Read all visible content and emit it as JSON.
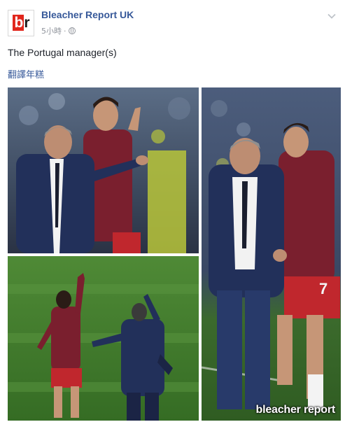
{
  "post": {
    "page_name": "Bleacher Report UK",
    "timestamp": "5小時",
    "separator": "·",
    "privacy_icon": "globe-icon",
    "menu_icon": "chevron-down-icon",
    "caption": "The Portugal manager(s)",
    "translate_link": "翻譯年糕"
  },
  "avatar": {
    "logo_part1": "b",
    "logo_part2": "r",
    "brand_color": "#e1261c"
  },
  "photo": {
    "watermark": "bleacher report"
  },
  "colors": {
    "link": "#365899",
    "meta": "#90949c",
    "text": "#1d2129",
    "pitch": "#3f7a2a",
    "jersey": "#7a1f2e",
    "suit": "#22305a"
  }
}
